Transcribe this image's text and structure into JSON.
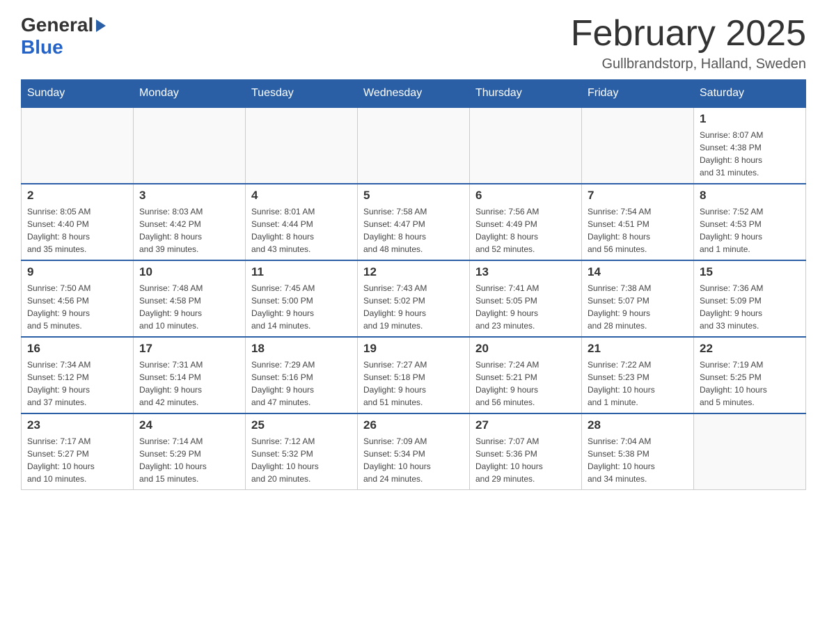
{
  "header": {
    "logo_general": "General",
    "logo_blue": "Blue",
    "title": "February 2025",
    "location": "Gullbrandstorp, Halland, Sweden"
  },
  "weekdays": [
    "Sunday",
    "Monday",
    "Tuesday",
    "Wednesday",
    "Thursday",
    "Friday",
    "Saturday"
  ],
  "weeks": [
    [
      {
        "day": "",
        "info": ""
      },
      {
        "day": "",
        "info": ""
      },
      {
        "day": "",
        "info": ""
      },
      {
        "day": "",
        "info": ""
      },
      {
        "day": "",
        "info": ""
      },
      {
        "day": "",
        "info": ""
      },
      {
        "day": "1",
        "info": "Sunrise: 8:07 AM\nSunset: 4:38 PM\nDaylight: 8 hours\nand 31 minutes."
      }
    ],
    [
      {
        "day": "2",
        "info": "Sunrise: 8:05 AM\nSunset: 4:40 PM\nDaylight: 8 hours\nand 35 minutes."
      },
      {
        "day": "3",
        "info": "Sunrise: 8:03 AM\nSunset: 4:42 PM\nDaylight: 8 hours\nand 39 minutes."
      },
      {
        "day": "4",
        "info": "Sunrise: 8:01 AM\nSunset: 4:44 PM\nDaylight: 8 hours\nand 43 minutes."
      },
      {
        "day": "5",
        "info": "Sunrise: 7:58 AM\nSunset: 4:47 PM\nDaylight: 8 hours\nand 48 minutes."
      },
      {
        "day": "6",
        "info": "Sunrise: 7:56 AM\nSunset: 4:49 PM\nDaylight: 8 hours\nand 52 minutes."
      },
      {
        "day": "7",
        "info": "Sunrise: 7:54 AM\nSunset: 4:51 PM\nDaylight: 8 hours\nand 56 minutes."
      },
      {
        "day": "8",
        "info": "Sunrise: 7:52 AM\nSunset: 4:53 PM\nDaylight: 9 hours\nand 1 minute."
      }
    ],
    [
      {
        "day": "9",
        "info": "Sunrise: 7:50 AM\nSunset: 4:56 PM\nDaylight: 9 hours\nand 5 minutes."
      },
      {
        "day": "10",
        "info": "Sunrise: 7:48 AM\nSunset: 4:58 PM\nDaylight: 9 hours\nand 10 minutes."
      },
      {
        "day": "11",
        "info": "Sunrise: 7:45 AM\nSunset: 5:00 PM\nDaylight: 9 hours\nand 14 minutes."
      },
      {
        "day": "12",
        "info": "Sunrise: 7:43 AM\nSunset: 5:02 PM\nDaylight: 9 hours\nand 19 minutes."
      },
      {
        "day": "13",
        "info": "Sunrise: 7:41 AM\nSunset: 5:05 PM\nDaylight: 9 hours\nand 23 minutes."
      },
      {
        "day": "14",
        "info": "Sunrise: 7:38 AM\nSunset: 5:07 PM\nDaylight: 9 hours\nand 28 minutes."
      },
      {
        "day": "15",
        "info": "Sunrise: 7:36 AM\nSunset: 5:09 PM\nDaylight: 9 hours\nand 33 minutes."
      }
    ],
    [
      {
        "day": "16",
        "info": "Sunrise: 7:34 AM\nSunset: 5:12 PM\nDaylight: 9 hours\nand 37 minutes."
      },
      {
        "day": "17",
        "info": "Sunrise: 7:31 AM\nSunset: 5:14 PM\nDaylight: 9 hours\nand 42 minutes."
      },
      {
        "day": "18",
        "info": "Sunrise: 7:29 AM\nSunset: 5:16 PM\nDaylight: 9 hours\nand 47 minutes."
      },
      {
        "day": "19",
        "info": "Sunrise: 7:27 AM\nSunset: 5:18 PM\nDaylight: 9 hours\nand 51 minutes."
      },
      {
        "day": "20",
        "info": "Sunrise: 7:24 AM\nSunset: 5:21 PM\nDaylight: 9 hours\nand 56 minutes."
      },
      {
        "day": "21",
        "info": "Sunrise: 7:22 AM\nSunset: 5:23 PM\nDaylight: 10 hours\nand 1 minute."
      },
      {
        "day": "22",
        "info": "Sunrise: 7:19 AM\nSunset: 5:25 PM\nDaylight: 10 hours\nand 5 minutes."
      }
    ],
    [
      {
        "day": "23",
        "info": "Sunrise: 7:17 AM\nSunset: 5:27 PM\nDaylight: 10 hours\nand 10 minutes."
      },
      {
        "day": "24",
        "info": "Sunrise: 7:14 AM\nSunset: 5:29 PM\nDaylight: 10 hours\nand 15 minutes."
      },
      {
        "day": "25",
        "info": "Sunrise: 7:12 AM\nSunset: 5:32 PM\nDaylight: 10 hours\nand 20 minutes."
      },
      {
        "day": "26",
        "info": "Sunrise: 7:09 AM\nSunset: 5:34 PM\nDaylight: 10 hours\nand 24 minutes."
      },
      {
        "day": "27",
        "info": "Sunrise: 7:07 AM\nSunset: 5:36 PM\nDaylight: 10 hours\nand 29 minutes."
      },
      {
        "day": "28",
        "info": "Sunrise: 7:04 AM\nSunset: 5:38 PM\nDaylight: 10 hours\nand 34 minutes."
      },
      {
        "day": "",
        "info": ""
      }
    ]
  ]
}
